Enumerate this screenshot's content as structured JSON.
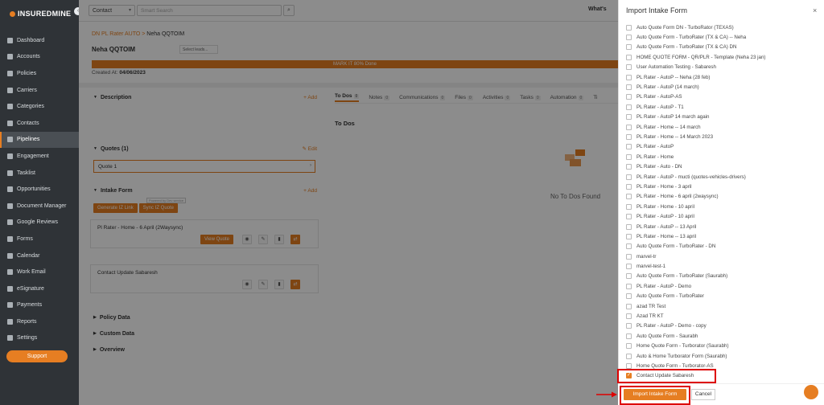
{
  "sidebar": {
    "logo": "INSUREDMINE",
    "items": [
      {
        "label": "Dashboard",
        "icon": "grid-icon"
      },
      {
        "label": "Accounts",
        "icon": "users-icon"
      },
      {
        "label": "Policies",
        "icon": "file-icon"
      },
      {
        "label": "Carriers",
        "icon": "building-icon"
      },
      {
        "label": "Categories",
        "icon": "category-icon"
      },
      {
        "label": "Contacts",
        "icon": "contact-icon"
      },
      {
        "label": "Pipelines",
        "icon": "funnel-icon"
      },
      {
        "label": "Engagement",
        "icon": "megaphone-icon"
      },
      {
        "label": "Tasklist",
        "icon": "list-icon"
      },
      {
        "label": "Opportunities",
        "icon": "chart-icon"
      },
      {
        "label": "Document Manager",
        "icon": "folder-icon"
      },
      {
        "label": "Google Reviews",
        "icon": "google-icon"
      },
      {
        "label": "Forms",
        "icon": "form-icon"
      },
      {
        "label": "Calendar",
        "icon": "calendar-icon"
      },
      {
        "label": "Work Email",
        "icon": "mail-icon"
      },
      {
        "label": "eSignature",
        "icon": "signature-icon"
      },
      {
        "label": "Payments",
        "icon": "dollar-icon"
      },
      {
        "label": "Reports",
        "icon": "report-icon"
      },
      {
        "label": "Settings",
        "icon": "gear-icon"
      }
    ],
    "support_label": "Support"
  },
  "topbar": {
    "select_value": "Contact",
    "search_placeholder": "Smart Search",
    "whats_new": "What's"
  },
  "page": {
    "breadcrumb_parent": "DN PL Rater AUTO",
    "breadcrumb_current": "Neha QQTOIM",
    "name": "Neha QQTOIM",
    "search_leads": "Select leads...",
    "banner": "MARK IT 80% Done",
    "created_label": "Created At:",
    "created_date": "04/06/2023"
  },
  "left": {
    "description": "Description",
    "add": "Add",
    "quotes": "Quotes (1)",
    "edit": "Edit",
    "quote1": "Quote 1",
    "intake_form": "Intake Form",
    "generate_btn": "Generate IZ Link",
    "sync_btn": "Sync IZ Quote",
    "powered": "Powered by Dev service",
    "card1_title": "Pl Rater - Home - 6 April (2Waysync)",
    "view_quote": "View Quote",
    "card2_title": "Contact Update Sabaresh",
    "policy_data": "Policy Data",
    "custom_data": "Custom Data",
    "overview": "Overview"
  },
  "right": {
    "tabs": [
      {
        "label": "To Dos",
        "count": "0"
      },
      {
        "label": "Notes",
        "count": "0"
      },
      {
        "label": "Communications",
        "count": "0"
      },
      {
        "label": "Files",
        "count": "0"
      },
      {
        "label": "Activities",
        "count": "0"
      },
      {
        "label": "Tasks",
        "count": "0"
      },
      {
        "label": "Automation",
        "count": "0"
      },
      {
        "label": "Ti",
        "count": ""
      }
    ],
    "todos_heading": "To Dos",
    "empty": "No To Dos Found"
  },
  "modal": {
    "title": "Import Intake Form",
    "close": "×",
    "forms": [
      "Auto Quote Form DN - TurboRator (TEXAS)",
      "Auto Quote Form - TurboRater (TX & CA) -- Neha",
      "Auto Quote Form - TurboRater (TX & CA) DN",
      "HOME QUOTE FORM - QR/PLR - Template (Neha 23 jan)",
      "User Automation Testing - Sabaresh",
      "PL Rater - AutoP -- Neha (28 feb)",
      "PL Rater - AutoP (14 march)",
      "PL Rater - AutoP-AS",
      "PL Rater - AutoP - T1",
      "PL Rater - AutoP 14 march again",
      "PL Rater - Home -- 14 march",
      "PL Rater - Home -- 14 March 2023",
      "PL Rater - AutoP",
      "PL Rater - Home",
      "PL Rater - Auto - DN",
      "PL Rater - AutoP - mucti (quotes-vehicles-drivers)",
      "PL Rater - Home - 3 april",
      "PL Rater - Home - 6 april (2waysync)",
      "PL Rater - Home - 10 april",
      "PL Rater - AutoP - 10 april",
      "PL Rater - AutoP -- 13 April",
      "PL Rater - Home -- 13 april",
      "Auto Quote Form - TurboRater - DN",
      "marvel-tr",
      "marvel-test-1",
      "Auto Quote Form - TurboRater (Saurabh)",
      "PL Rater - AutoP - Demo",
      "Auto Quote Form - TurboRater",
      "azad TR Test",
      "Azad TR KT",
      "PL Rater - AutoP - Demo - copy",
      "Auto Quote Form - Saurabh",
      "Home Quote Form - Turborator (Saurabh)",
      "Auto & Home Turborator Form (Saurabh)",
      "Home Quote Form - Turborator-AS",
      "Contact Update Sabaresh"
    ],
    "checked_index": 35,
    "import_btn": "Import Intake Form",
    "cancel_btn": "Cancel"
  },
  "colors": {
    "accent": "#e67e22",
    "highlight": "#dd0000",
    "sidebar": "#2f3337"
  }
}
